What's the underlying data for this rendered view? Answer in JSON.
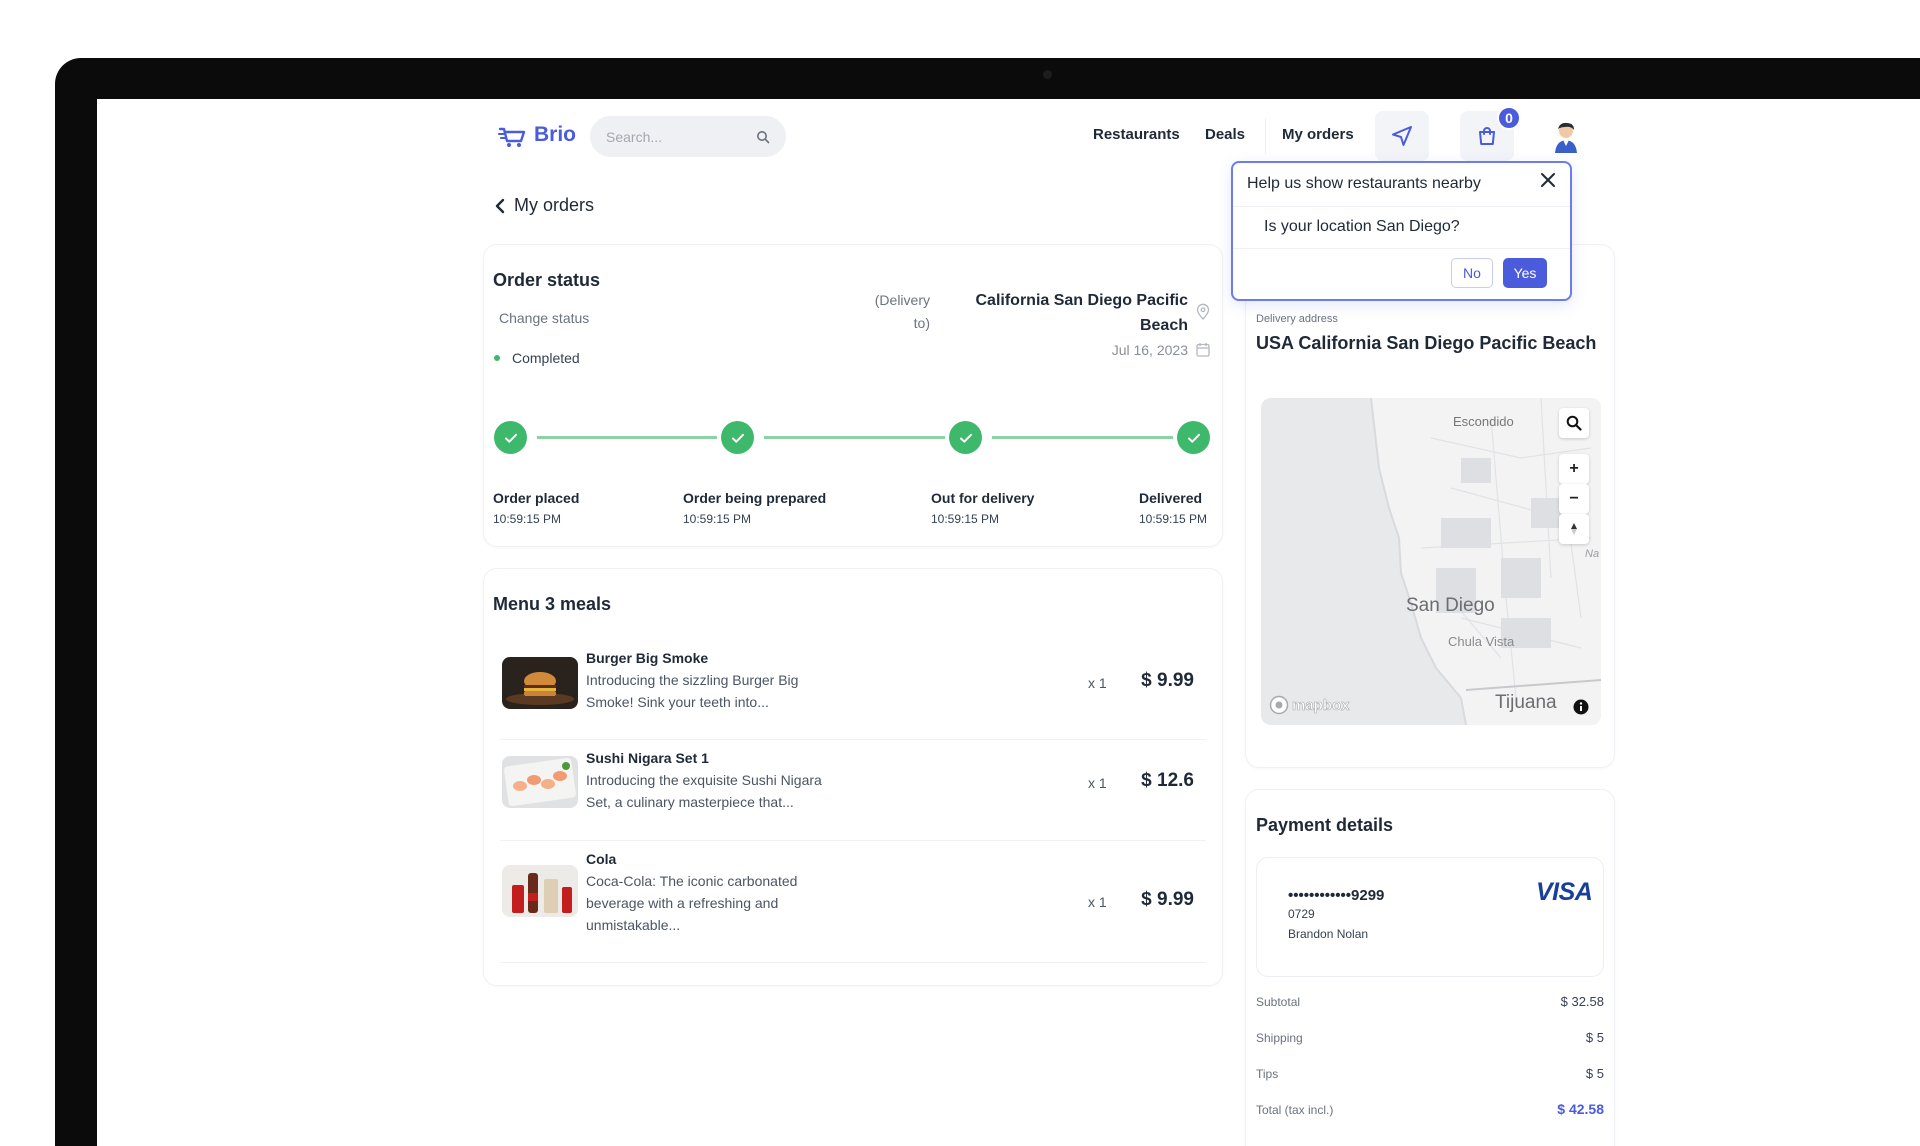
{
  "header": {
    "logo_text": "Brio",
    "search_placeholder": "Search...",
    "nav": [
      "Restaurants",
      "Deals",
      "My orders"
    ],
    "cart_count": "0"
  },
  "back_label": "My orders",
  "order_status": {
    "title": "Order status",
    "change_status": "Change status",
    "status": "Completed",
    "delivery_to_label": "(Delivery to)",
    "destination": "California San Diego Pacific Beach",
    "date": "Jul 16, 2023",
    "steps": [
      {
        "label": "Order placed",
        "time": "10:59:15 PM"
      },
      {
        "label": "Order being prepared",
        "time": "10:59:15 PM"
      },
      {
        "label": "Out for delivery",
        "time": "10:59:15 PM"
      },
      {
        "label": "Delivered",
        "time": "10:59:15 PM"
      }
    ]
  },
  "menu": {
    "title": "Menu 3 meals",
    "items": [
      {
        "name": "Burger Big Smoke",
        "desc": "Introducing the sizzling Burger Big Smoke! Sink your teeth into...",
        "qty": "x 1",
        "price": "$ 9.99"
      },
      {
        "name": "Sushi Nigara Set 1",
        "desc": "Introducing the exquisite Sushi Nigara Set, a culinary masterpiece that...",
        "qty": "x 1",
        "price": "$ 12.6"
      },
      {
        "name": "Cola",
        "desc": "Coca-Cola: The iconic carbonated beverage with a refreshing and unmistakable...",
        "qty": "x 1",
        "price": "$ 9.99"
      }
    ]
  },
  "delivery": {
    "label": "Delivery address",
    "address": "USA California San Diego Pacific Beach",
    "map_labels": {
      "escondido": "Escondido",
      "san_diego": "San Diego",
      "chula_vista": "Chula Vista",
      "tijuana": "Tijuana",
      "mapbox": "mapbox",
      "na": "Na"
    },
    "map_controls": {
      "zoom_in": "+",
      "zoom_out": "−"
    }
  },
  "payment": {
    "title": "Payment details",
    "card_number": "••••••••••••9299",
    "card_exp": "0729",
    "card_holder": "Brandon Nolan",
    "card_brand": "VISA",
    "summary": [
      {
        "label": "Subtotal",
        "value": "$ 32.58"
      },
      {
        "label": "Shipping",
        "value": "$ 5"
      },
      {
        "label": "Tips",
        "value": "$ 5"
      },
      {
        "label": "Total (tax incl.)",
        "value": "$ 42.58"
      }
    ]
  },
  "popup": {
    "title": "Help us show restaurants nearby",
    "question": "Is your location San Diego?",
    "no_label": "No",
    "yes_label": "Yes"
  },
  "colors": {
    "accent": "#4a5bdc",
    "success": "#3eb86b",
    "success_line": "#8bd3a4"
  }
}
